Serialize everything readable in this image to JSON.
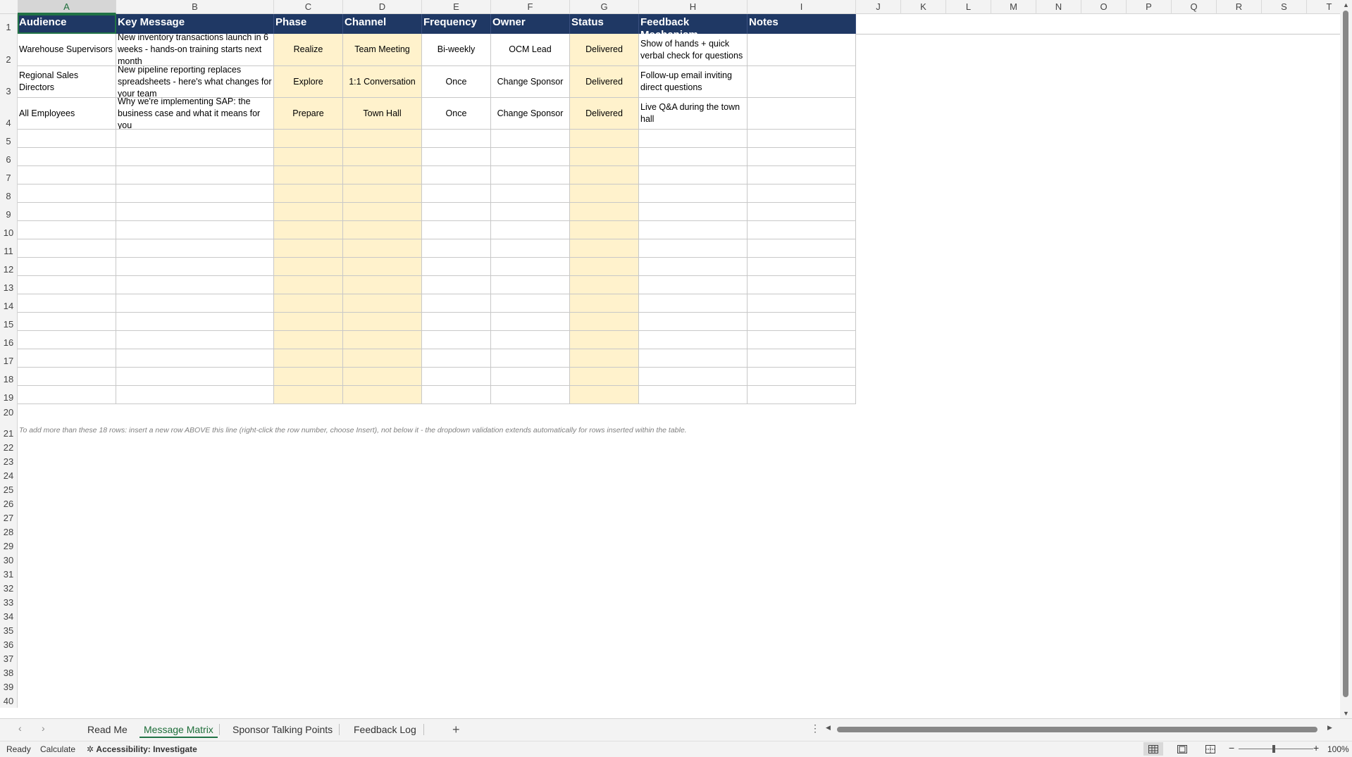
{
  "columns": [
    "A",
    "B",
    "C",
    "D",
    "E",
    "F",
    "G",
    "H",
    "I",
    "J",
    "K",
    "L",
    "M",
    "N",
    "O",
    "P",
    "Q",
    "R",
    "S",
    "T"
  ],
  "table": {
    "headers": [
      "Audience",
      "Key Message",
      "Phase",
      "Channel",
      "Frequency",
      "Owner",
      "Status",
      "Feedback Mechanism",
      "Notes"
    ],
    "rows": [
      [
        "Warehouse Supervisors",
        "New inventory transactions launch in 6 weeks - hands-on training starts next month",
        "Realize",
        "Team Meeting",
        "Bi-weekly",
        "OCM Lead",
        "Delivered",
        "Show of hands + quick verbal check for questions",
        ""
      ],
      [
        "Regional Sales Directors",
        "New pipeline reporting replaces spreadsheets - here's what changes for your team",
        "Explore",
        "1:1 Conversation",
        "Once",
        "Change Sponsor",
        "Delivered",
        "Follow-up email inviting direct questions",
        ""
      ],
      [
        "All Employees",
        "Why we're implementing SAP: the business case and what it means for you",
        "Prepare",
        "Town Hall",
        "Once",
        "Change Sponsor",
        "Delivered",
        "Live Q&A during the town hall",
        ""
      ]
    ]
  },
  "row_numbers": [
    "1",
    "2",
    "3",
    "4",
    "5",
    "6",
    "7",
    "8",
    "9",
    "10",
    "11",
    "12",
    "13",
    "14",
    "15",
    "16",
    "17",
    "18",
    "19",
    "20",
    "21",
    "22",
    "23",
    "24",
    "25",
    "26",
    "27",
    "28",
    "29",
    "30",
    "31",
    "32",
    "33",
    "34",
    "35",
    "36",
    "37",
    "38",
    "39",
    "40"
  ],
  "note": "To add more than these 18 rows: insert a new row ABOVE this line (right-click the row number, choose Insert), not below it - the dropdown validation extends automatically for rows inserted within the table.",
  "sheet_tabs": [
    "Read Me",
    "Message Matrix",
    "Sponsor Talking Points",
    "Feedback Log"
  ],
  "active_tab": "Message Matrix",
  "status": {
    "ready": "Ready",
    "calculate": "Calculate",
    "accessibility": "Accessibility: Investigate",
    "zoom": "100%"
  },
  "colors": {
    "header_bg": "#1f3864",
    "highlight_col": "#fff2cc",
    "accent": "#217346"
  }
}
